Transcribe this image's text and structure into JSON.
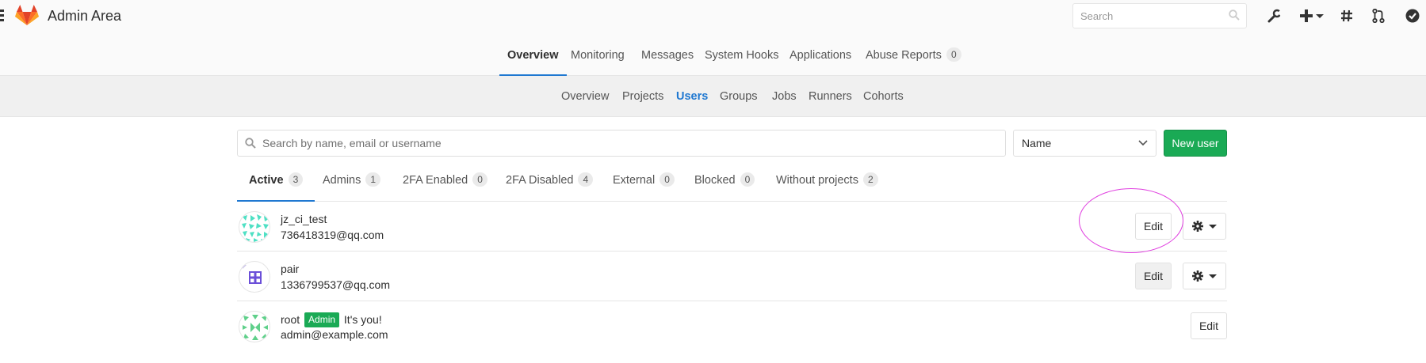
{
  "header": {
    "title": "Admin Area",
    "search_placeholder": "Search"
  },
  "main_nav": [
    {
      "label": "Overview",
      "active": true
    },
    {
      "label": "Monitoring"
    },
    {
      "label": "Messages"
    },
    {
      "label": "System Hooks"
    },
    {
      "label": "Applications"
    },
    {
      "label": "Abuse Reports",
      "count": "0"
    }
  ],
  "sub_nav": [
    {
      "label": "Overview"
    },
    {
      "label": "Projects"
    },
    {
      "label": "Users",
      "active": true
    },
    {
      "label": "Groups"
    },
    {
      "label": "Jobs"
    },
    {
      "label": "Runners"
    },
    {
      "label": "Cohorts"
    }
  ],
  "filters": {
    "search_placeholder": "Search by name, email or username",
    "sort_value": "Name",
    "new_user_label": "New user"
  },
  "scope_tabs": [
    {
      "label": "Active",
      "count": "3",
      "active": true
    },
    {
      "label": "Admins",
      "count": "1"
    },
    {
      "label": "2FA Enabled",
      "count": "0"
    },
    {
      "label": "2FA Disabled",
      "count": "4"
    },
    {
      "label": "External",
      "count": "0"
    },
    {
      "label": "Blocked",
      "count": "0"
    },
    {
      "label": "Without projects",
      "count": "2"
    }
  ],
  "users": [
    {
      "name": "jz_ci_test",
      "email": "736418319@qq.com",
      "edit_label": "Edit"
    },
    {
      "name": "pair",
      "email": "1336799537@qq.com",
      "edit_label": "Edit"
    },
    {
      "name": "root",
      "admin_badge": "Admin",
      "note": "It's you!",
      "email": "admin@example.com",
      "edit_label": "Edit"
    }
  ],
  "colors": {
    "brand_green": "#1aaa55",
    "active_blue": "#1f78d1",
    "annotation": "#e040e0"
  }
}
